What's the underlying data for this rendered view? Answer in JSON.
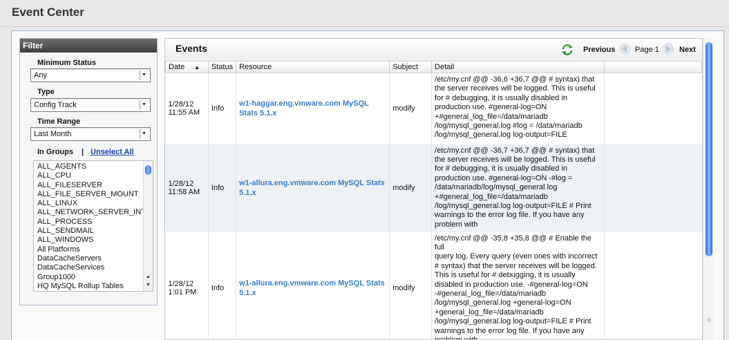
{
  "page": {
    "title": "Event Center"
  },
  "filter": {
    "header": "Filter",
    "minimum_status": {
      "label": "Minimum Status",
      "value": "Any"
    },
    "type": {
      "label": "Type",
      "value": "Config Track"
    },
    "time_range": {
      "label": "Time Range",
      "value": "Last Month"
    },
    "in_groups_label": "In Groups",
    "separator": "|",
    "unselect_all": "Unselect All",
    "groups": [
      "ALL_AGENTS",
      "ALL_CPU",
      "ALL_FILESERVER",
      "ALL_FILE_SERVER_MOUNT",
      "ALL_LINUX",
      "ALL_NETWORK_SERVER_INT",
      "ALL_PROCESS",
      "ALL_SENDMAIL",
      "ALL_WINDOWS",
      "All Platforms",
      "DataCacheServers",
      "DataCacheServices",
      "Group1000",
      "HQ MySQL Rollup Tables"
    ]
  },
  "events": {
    "title": "Events",
    "pager": {
      "previous": "Previous",
      "page": "Page 1",
      "next": "Next"
    },
    "columns": [
      "Date",
      "Status",
      "Resource",
      "Subject",
      "Detail"
    ],
    "sort_indicator": "▲",
    "rows": [
      {
        "date": "1/28/12",
        "time": "11:55 AM",
        "status": "Info",
        "resource": "w1-haggar.eng.vmware.com MySQL Stats 5.1.x",
        "subject": "modify",
        "detail": [
          "/etc/my.cnf @@ -36,6 +36,7 @@ # syntax) that",
          "the server receives will be logged. This is useful",
          "for # debugging, it is usually disabled in",
          "production use. #general-log=ON",
          "+#general_log_file=/data/mariadb",
          "/log/mysql_general.log #log = /data/mariadb",
          "/log/mysql_general.log log-output=FILE"
        ]
      },
      {
        "date": "1/28/12",
        "time": "11:58 AM",
        "status": "Info",
        "resource": "w1-allura.eng.vmware.com MySQL Stats 5.1.x",
        "subject": "modify",
        "detail": [
          "/etc/my.cnf @@ -36,7 +36,7 @@ # syntax) that",
          "the server receives will be logged. This is useful",
          "for # debugging, it is usually disabled in",
          "production use. #general-log=ON -#log =",
          "/data/mariadb/log/mysql_general.log",
          "+#general_log_file=/data/mariadb",
          "/log/mysql_general.log log-output=FILE # Print",
          "warnings to the error log file. If you have any",
          "problem with"
        ]
      },
      {
        "date": "1/28/12",
        "time": "1:01 PM",
        "status": "Info",
        "resource": "w1-allura.eng.vmware.com MySQL Stats 5.1.x",
        "subject": "modify",
        "detail": [
          "/etc/my.cnf @@ -35,8 +35,8 @@ # Enable the full",
          "query log. Every query (even ones with incorrect",
          "# syntax) that the server receives will be logged.",
          "This is useful for # debugging, it is usually",
          "disabled in production use. -#general-log=ON",
          "-#general_log_file=/data/mariadb",
          "/log/mysql_general.log +general-log=ON",
          "+general_log_file=/data/mariadb",
          "/log/mysql_general.log log-output=FILE # Print",
          "warnings to the error log file. If you have any",
          "problem with"
        ]
      }
    ]
  },
  "colors": {
    "link": "#3a7dc9",
    "unselect_link": "#1a3fb5",
    "scroll_thumb": "#3f79d8"
  }
}
